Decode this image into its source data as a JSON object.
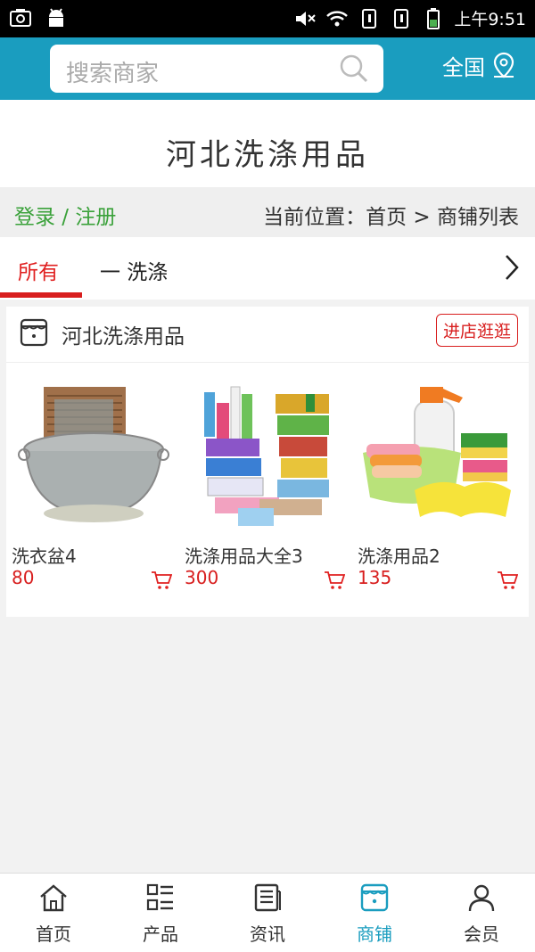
{
  "status_bar": {
    "time": "上午9:51",
    "icons": [
      "camera-icon",
      "android-icon",
      "mute-icon",
      "wifi-icon",
      "sim1-icon",
      "sim2-icon",
      "battery-icon"
    ]
  },
  "search": {
    "placeholder": "搜索商家"
  },
  "region": {
    "label": "全国"
  },
  "page_title": "河北洗涤用品",
  "auth": {
    "login_register": "登录 / 注册"
  },
  "breadcrumb": "当前位置：首页 > 商铺列表",
  "tabs": [
    {
      "label": "所有",
      "active": true
    },
    {
      "label": "一 洗涤",
      "active": false
    }
  ],
  "shop": {
    "name": "河北洗涤用品",
    "enter_label": "进店逛逛",
    "products": [
      {
        "name": "洗衣盆4",
        "price": "80",
        "image": "washboard-basin"
      },
      {
        "name": "洗涤用品大全3",
        "price": "300",
        "image": "detergent-collection"
      },
      {
        "name": "洗涤用品2",
        "price": "135",
        "image": "cleaning-sponges-gloves"
      }
    ]
  },
  "bottom_nav": [
    {
      "label": "首页",
      "icon": "home-icon",
      "active": false
    },
    {
      "label": "产品",
      "icon": "grid-list-icon",
      "active": false
    },
    {
      "label": "资讯",
      "icon": "news-icon",
      "active": false
    },
    {
      "label": "商铺",
      "icon": "store-icon",
      "active": true
    },
    {
      "label": "会员",
      "icon": "user-icon",
      "active": false
    }
  ],
  "colors": {
    "accent": "#1a9dbf",
    "highlight": "#d81e1e",
    "login": "#3aa13a"
  }
}
